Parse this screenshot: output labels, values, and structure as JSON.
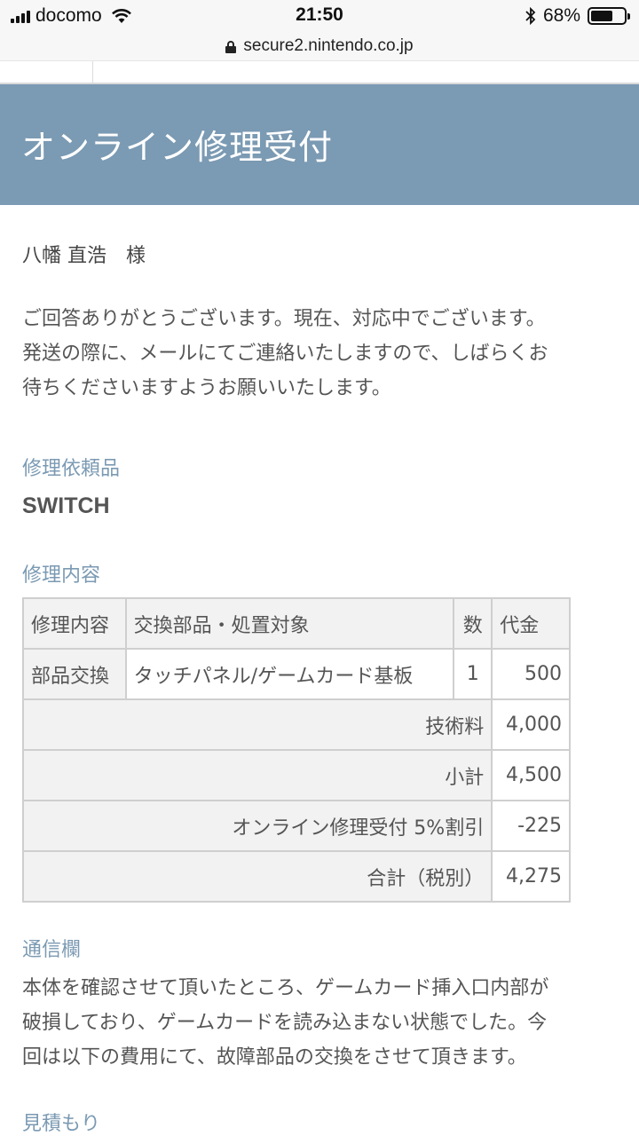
{
  "status_bar": {
    "carrier": "docomo",
    "time": "21:50",
    "battery_percent": "68%",
    "battery_level": 0.68
  },
  "browser": {
    "url": "secure2.nintendo.co.jp"
  },
  "banner": {
    "title": "オンライン修理受付"
  },
  "customer_name": "八幡 直浩　様",
  "message_lines": [
    "ご回答ありがとうございます。現在、対応中でございます。",
    "発送の際に、メールにてご連絡いたしますので、しばらくお",
    "待ちくださいますようお願いいたします。"
  ],
  "repair_item": {
    "label": "修理依頼品",
    "value": "SWITCH"
  },
  "repair_details": {
    "label": "修理内容",
    "table": {
      "headers": [
        "修理内容",
        "交換部品・処置対象",
        "数",
        "代金"
      ],
      "rows": [
        {
          "type": "部品交換",
          "part": "タッチパネル/ゲームカード基板",
          "qty": "1",
          "price": "500"
        }
      ],
      "summary": [
        {
          "label": "技術料",
          "value": "4,000"
        },
        {
          "label": "小計",
          "value": "4,500"
        },
        {
          "label": "オンライン修理受付 5%割引",
          "value": "-225"
        },
        {
          "label": "合計（税別）",
          "value": "4,275"
        }
      ]
    }
  },
  "communication": {
    "label": "通信欄",
    "lines": [
      "本体を確認させて頂いたところ、ゲームカード挿入口内部が",
      "破損しており、ゲームカードを読み込まない状態でした。今",
      "回は以下の費用にて、故障部品の交換をさせて頂きます。"
    ]
  },
  "estimate": {
    "label": "見積もり"
  }
}
